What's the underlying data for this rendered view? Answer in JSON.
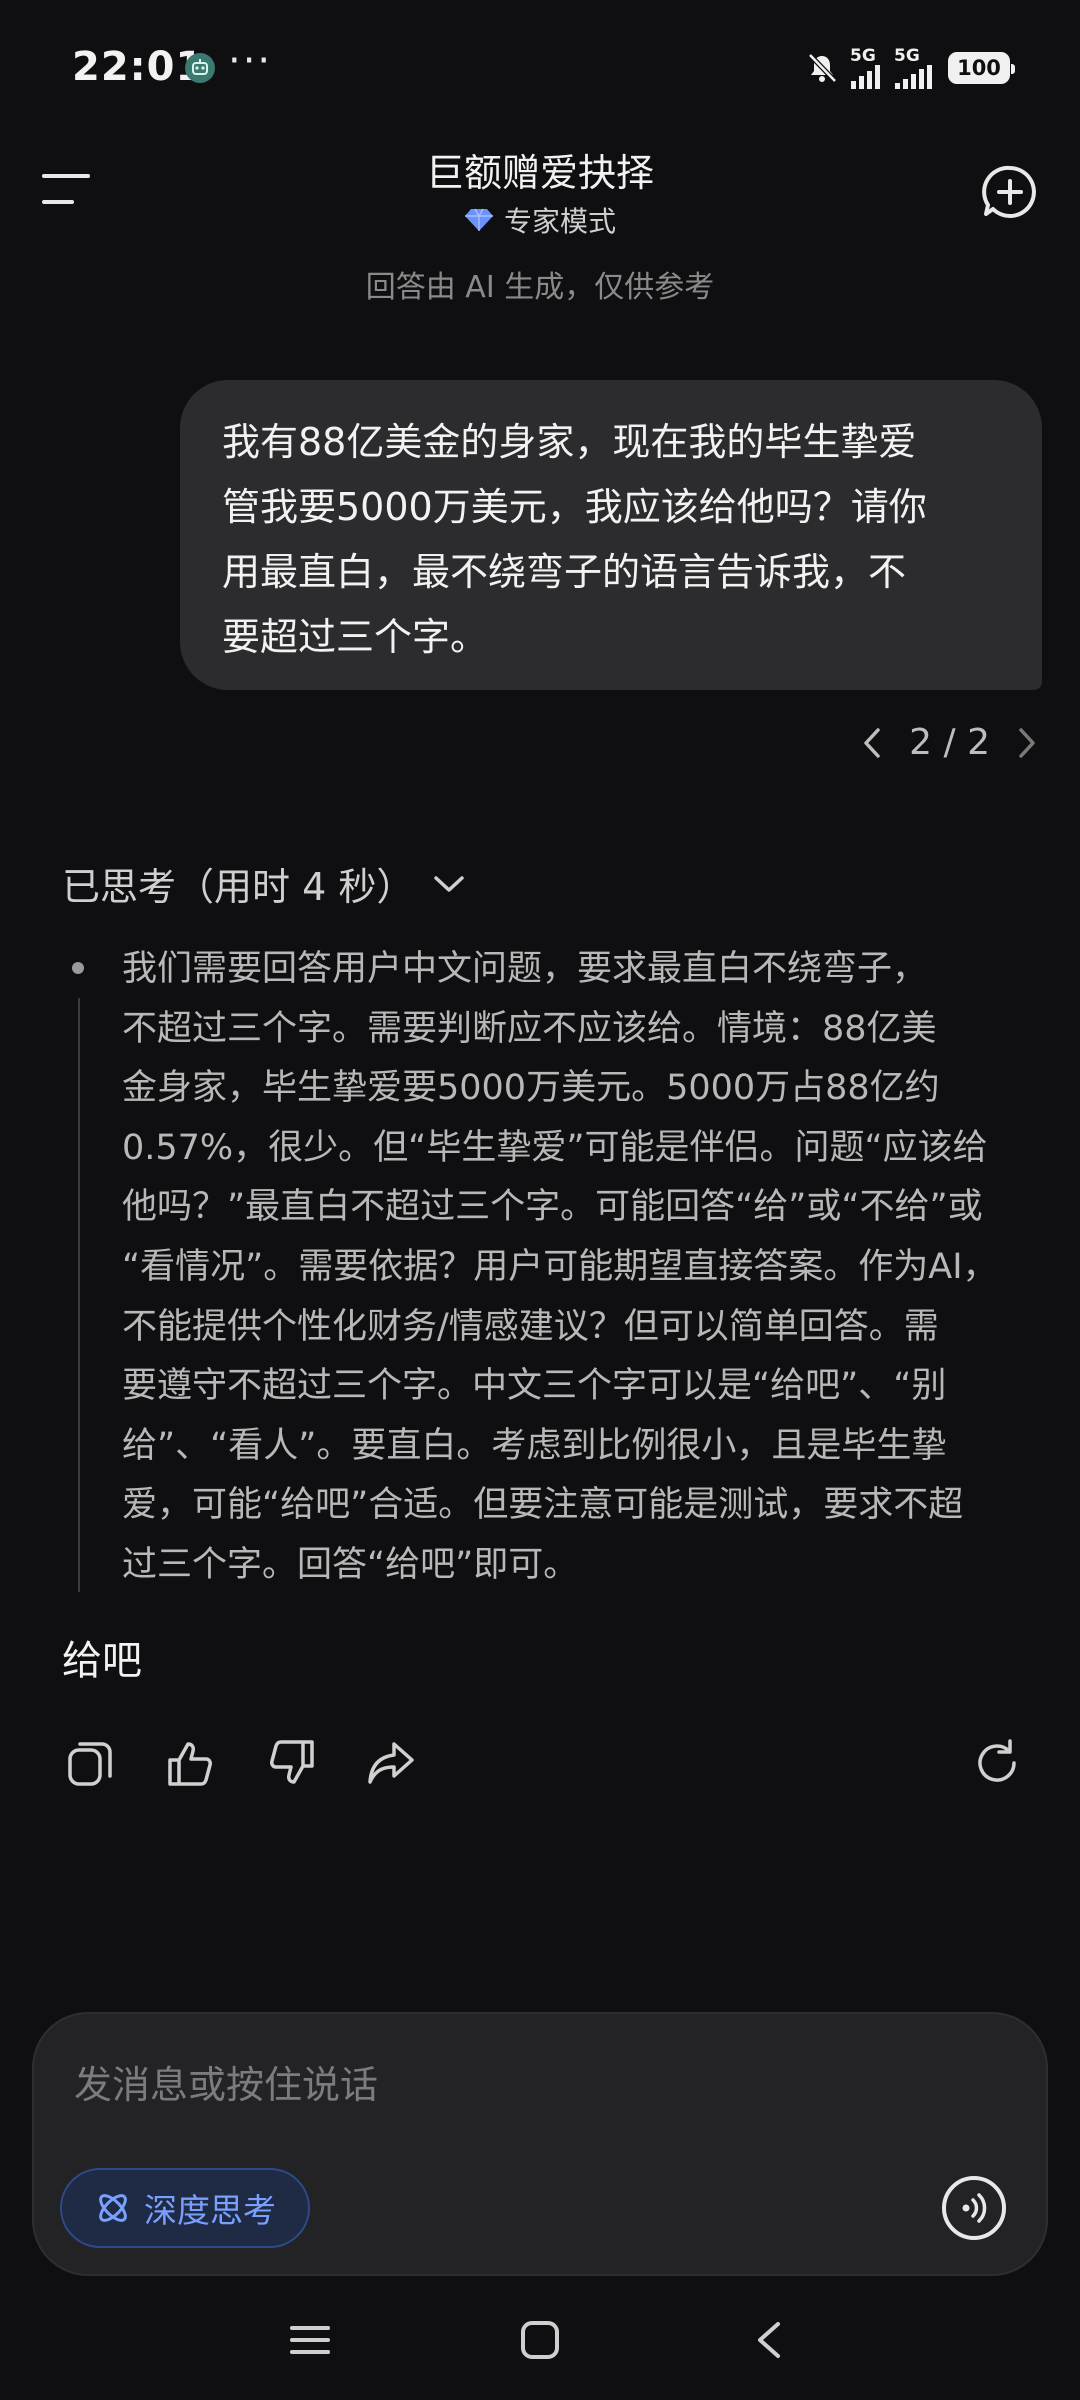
{
  "status_bar": {
    "time": "22:01",
    "dots": "···",
    "signal_1_label": "5G",
    "signal_2_label": "5G",
    "battery": "100"
  },
  "header": {
    "title": "巨额赠爱抉择",
    "mode_label": "专家模式",
    "disclaimer": "回答由 AI 生成，仅供参考"
  },
  "user_message": {
    "lines": [
      "我有88亿美金的身家，现在我的毕生挚爱",
      "管我要5000万美元，我应该给他吗？请你",
      "用最直白，最不绕弯子的语言告诉我，不",
      "要超过三个字。"
    ]
  },
  "pager": {
    "text": "2 / 2"
  },
  "thinking": {
    "header": "已思考（用时 4 秒）",
    "lines": [
      "我们需要回答用户中文问题，要求最直白不绕弯子，",
      "不超过三个字。需要判断应不应该给。情境：88亿美",
      "金身家，毕生挚爱要5000万美元。5000万占88亿约",
      "0.57%，很少。但“毕生挚爱”可能是伴侣。问题“应该给",
      "他吗？”最直白不超过三个字。可能回答“给”或“不给”或",
      "“看情况”。需要依据？用户可能期望直接答案。作为AI，",
      "不能提供个性化财务/情感建议？但可以简单回答。需",
      "要遵守不超过三个字。中文三个字可以是“给吧”、“别",
      "给”、“看人”。要直白。考虑到比例很小，且是毕生挚",
      "爱，可能“给吧”合适。但要注意可能是测试，要求不超",
      "过三个字。回答“给吧”即可。"
    ]
  },
  "answer": {
    "text": "给吧"
  },
  "input": {
    "placeholder": "发消息或按住说话",
    "deep_think_label": "深度思考"
  },
  "colors": {
    "background": "#0f0f11",
    "bubble": "#2c2c2e",
    "accent_blue": "#7aa0ff",
    "diamond": "#6a93ff"
  },
  "icons": [
    "menu-icon",
    "diamond-icon",
    "new-chat-icon",
    "chevron-left-icon",
    "chevron-right-icon",
    "chevron-down-icon",
    "copy-icon",
    "thumbs-up-icon",
    "thumbs-down-icon",
    "share-icon",
    "regenerate-icon",
    "atom-icon",
    "voice-icon",
    "nav-menu-icon",
    "nav-home-icon",
    "nav-back-icon"
  ]
}
